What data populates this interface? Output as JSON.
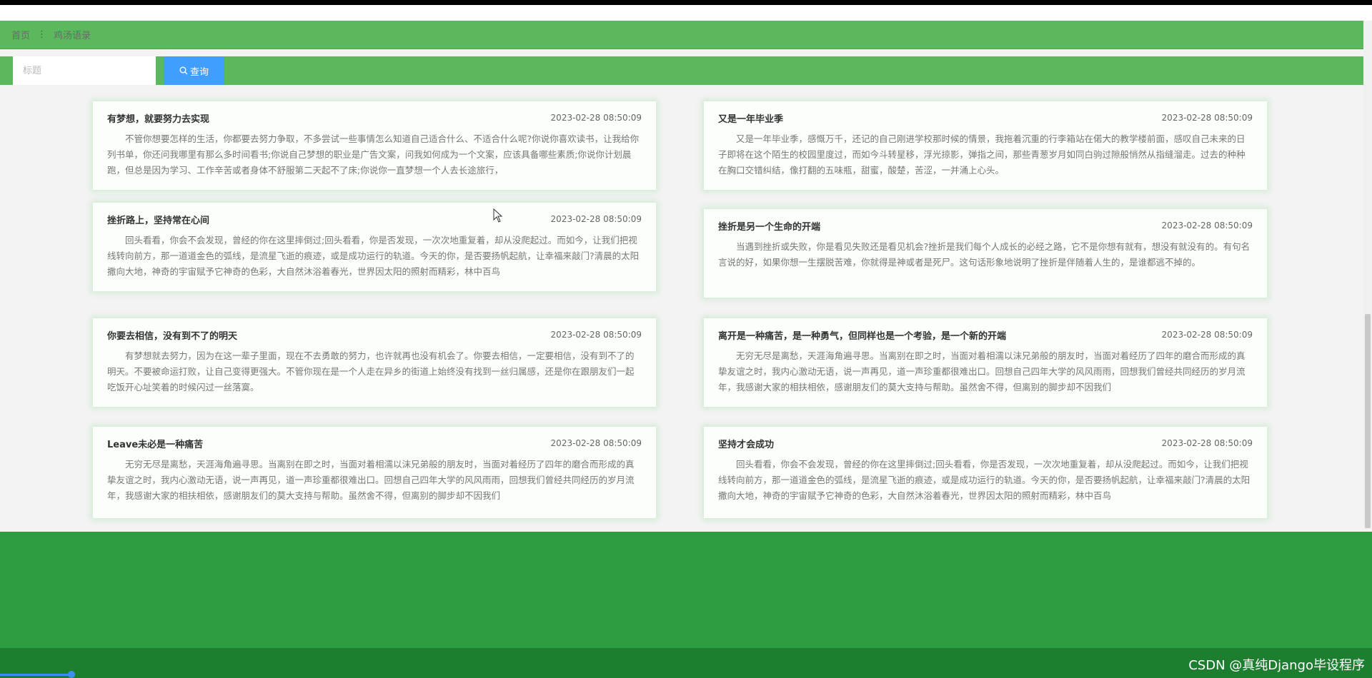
{
  "breadcrumb": {
    "home": "首页",
    "current": "鸡汤语录"
  },
  "search": {
    "placeholder": "标题",
    "button_label": "查询"
  },
  "posts": [
    {
      "title": "有梦想，就要努力去实现",
      "date": "2023-02-28 08:50:09",
      "content": "不管你想要怎样的生活，你都要去努力争取，不多尝试一些事情怎么知道自己适合什么、不适合什么呢?你说你喜欢读书，让我给你列书单，你还问我哪里有那么多时间看书;你说自己梦想的职业是广告文案，问我如何成为一个文案，应该具备哪些素质;你说你计划晨跑，但总是因为学习、工作辛苦或者身体不舒服第二天起不了床;你说你一直梦想一个人去长途旅行，"
    },
    {
      "title": "又是一年毕业季",
      "date": "2023-02-28 08:50:09",
      "content": "又是一年毕业季，感慨万千，还记的自己刚进学校那时候的情景，我拖着沉重的行李箱站在偌大的教学楼前面，感叹自己未来的日子即将在这个陌生的校园里度过，而如今斗转星移，浮光掠影，弹指之间，那些青葱岁月如同白驹过隙般悄然从指缝溜走。过去的种种在胸口交错纠结，像打翻的五味瓶，甜蜜，酸楚，苦涩，一并涌上心头。"
    },
    {
      "title": "挫折路上，坚持常在心间",
      "date": "2023-02-28 08:50:09",
      "content": "回头看看，你会不会发现，曾经的你在这里摔倒过;回头看看，你是否发现，一次次地重复着，却从没爬起过。而如今，让我们把视线转向前方，那一道道金色的弧线，是流星飞逝的痕迹，或是成功运行的轨道。今天的你，是否要扬帆起航，让幸福来敲门?清晨的太阳撒向大地，神奇的宇宙赋予它神奇的色彩，大自然沐浴着春光，世界因太阳的照射而精彩，林中百鸟"
    },
    {
      "title": "挫折是另一个生命的开端",
      "date": "2023-02-28 08:50:09",
      "content": "当遇到挫折或失败，你是看见失败还是看见机会?挫折是我们每个人成长的必经之路，它不是你想有就有，想没有就没有的。有句名言说的好，如果你想一生摆脱苦难，你就得是神或者是死尸。这句话形象地说明了挫折是伴随着人生的，是谁都逃不掉的。"
    },
    {
      "title": "你要去相信，没有到不了的明天",
      "date": "2023-02-28 08:50:09",
      "content": "有梦想就去努力，因为在这一辈子里面，现在不去勇敢的努力，也许就再也没有机会了。你要去相信，一定要相信，没有到不了的明天。不要被命运打败，让自己变得更强大。不管你现在是一个人走在异乡的街道上始终没有找到一丝归属感，还是你在跟朋友们一起吃饭开心址笑着的时候闪过一丝落寞。"
    },
    {
      "title": "离开是一种痛苦，是一种勇气，但同样也是一个考验，是一个新的开端",
      "date": "2023-02-28 08:50:09",
      "content": "无穷无尽是离愁，天涯海角遍寻思。当离别在即之时，当面对着相濡以沫兄弟般的朋友时，当面对着经历了四年的磨合而形成的真挚友谊之时，我内心激动无语，说一声再见，道一声珍重都很难出口。回想自己四年大学的风风雨雨，回想我们曾经共同经历的岁月流年，我感谢大家的相扶相依，感谢朋友们的莫大支持与帮助。虽然舍不得，但离别的脚步却不因我们"
    },
    {
      "title": "Leave未必是一种痛苦",
      "date": "2023-02-28 08:50:09",
      "content": "无穷无尽是离愁，天涯海角遍寻思。当离别在即之时，当面对着相濡以沫兄弟般的朋友时，当面对着经历了四年的磨合而形成的真挚友谊之时，我内心激动无语，说一声再见，道一声珍重都很难出口。回想自己四年大学的风风雨雨，回想我们曾经共同经历的岁月流年，我感谢大家的相扶相依，感谢朋友们的莫大支持与帮助。虽然舍不得，但离别的脚步却不因我们"
    },
    {
      "title": "坚持才会成功",
      "date": "2023-02-28 08:50:09",
      "content": "回头看看，你会不会发现，曾经的你在这里摔倒过;回头看看，你是否发现，一次次地重复着，却从没爬起过。而如今，让我们把视线转向前方，那一道道金色的弧线，是流星飞逝的痕迹，或是成功运行的轨道。今天的你，是否要扬帆起航，让幸福来敲门?清晨的太阳撒向大地，神奇的宇宙赋予它神奇的色彩，大自然沐浴着春光，世界因太阳的照射而精彩，林中百鸟"
    }
  ],
  "watermark": "CSDN @真纯Django毕设程序",
  "colors": {
    "header_green": "#5cb85c",
    "button_blue": "#409eff",
    "footer_green": "#2e9d42"
  }
}
